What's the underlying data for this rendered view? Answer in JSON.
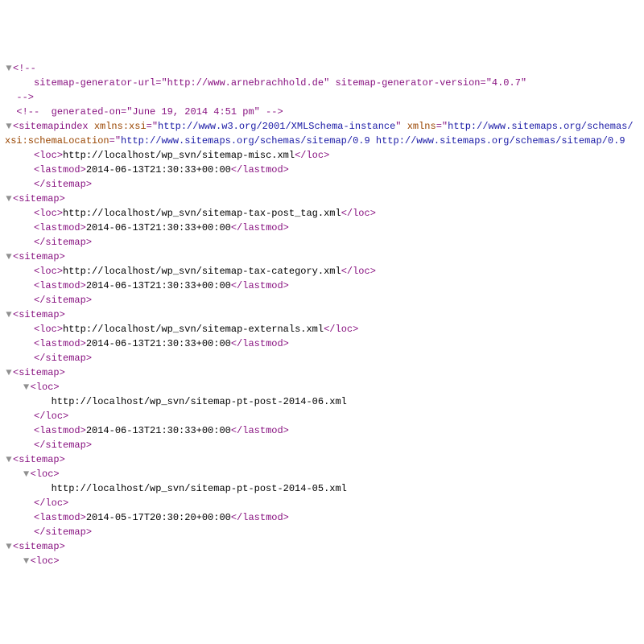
{
  "lines": [
    {
      "lvl": 0,
      "segs": [
        {
          "k": "arrow",
          "t": "▼"
        },
        {
          "c": "purple",
          "t": "<!--"
        }
      ]
    },
    {
      "lvl": 1,
      "segs": [
        {
          "c": "purple",
          "t": "sitemap-generator-url=\"http://www.arnebrachhold.de\" sitemap-generator-version=\"4.0.7\""
        }
      ]
    },
    {
      "lvl": 0,
      "segs": [
        {
          "c": "purple",
          "t": "-->"
        }
      ]
    },
    {
      "lvl": 0,
      "segs": [
        {
          "c": "purple",
          "t": "<!--  generated-on=\"June 19, 2014 4:51 pm\" -->"
        }
      ]
    },
    {
      "lvl": 0,
      "segs": [
        {
          "k": "arrow",
          "t": "▼"
        },
        {
          "c": "purple",
          "t": "<sitemapindex "
        },
        {
          "c": "brown",
          "t": "xmlns:xsi"
        },
        {
          "c": "purple",
          "t": "=\""
        },
        {
          "c": "blue",
          "t": "http://www.w3.org/2001/XMLSchema-instance"
        },
        {
          "c": "purple",
          "t": "\" "
        },
        {
          "c": "brown",
          "t": "xmlns"
        },
        {
          "c": "purple",
          "t": "=\""
        },
        {
          "c": "blue",
          "t": "http://www.sitemaps.org/schemas/"
        }
      ]
    },
    {
      "lvl": 0,
      "noindent": true,
      "segs": [
        {
          "c": "brown",
          "t": "xsi:schemaLocation"
        },
        {
          "c": "purple",
          "t": "=\""
        },
        {
          "c": "blue",
          "t": "http://www.sitemaps.org/schemas/sitemap/0.9 http://www.sitemaps.org/schemas/sitemap/0.9"
        }
      ]
    },
    {
      "lvl": 1,
      "segs": [
        {
          "c": "purple",
          "t": "<loc>"
        },
        {
          "c": "black",
          "t": "http://localhost/wp_svn/sitemap-misc.xml"
        },
        {
          "c": "purple",
          "t": "</loc>"
        }
      ]
    },
    {
      "lvl": 1,
      "segs": [
        {
          "c": "purple",
          "t": "<lastmod>"
        },
        {
          "c": "black",
          "t": "2014-06-13T21:30:33+00:00"
        },
        {
          "c": "purple",
          "t": "</lastmod>"
        }
      ]
    },
    {
      "lvl": 1,
      "segs": [
        {
          "c": "purple",
          "t": "</sitemap>"
        }
      ]
    },
    {
      "lvl": 0,
      "segs": [
        {
          "k": "arrow",
          "t": "▼"
        },
        {
          "c": "purple",
          "t": "<sitemap>"
        }
      ]
    },
    {
      "lvl": 1,
      "segs": [
        {
          "c": "purple",
          "t": "<loc>"
        },
        {
          "c": "black",
          "t": "http://localhost/wp_svn/sitemap-tax-post_tag.xml"
        },
        {
          "c": "purple",
          "t": "</loc>"
        }
      ]
    },
    {
      "lvl": 1,
      "segs": [
        {
          "c": "purple",
          "t": "<lastmod>"
        },
        {
          "c": "black",
          "t": "2014-06-13T21:30:33+00:00"
        },
        {
          "c": "purple",
          "t": "</lastmod>"
        }
      ]
    },
    {
      "lvl": 1,
      "segs": [
        {
          "c": "purple",
          "t": "</sitemap>"
        }
      ]
    },
    {
      "lvl": 0,
      "segs": [
        {
          "k": "arrow",
          "t": "▼"
        },
        {
          "c": "purple",
          "t": "<sitemap>"
        }
      ]
    },
    {
      "lvl": 1,
      "segs": [
        {
          "c": "purple",
          "t": "<loc>"
        },
        {
          "c": "black",
          "t": "http://localhost/wp_svn/sitemap-tax-category.xml"
        },
        {
          "c": "purple",
          "t": "</loc>"
        }
      ]
    },
    {
      "lvl": 1,
      "segs": [
        {
          "c": "purple",
          "t": "<lastmod>"
        },
        {
          "c": "black",
          "t": "2014-06-13T21:30:33+00:00"
        },
        {
          "c": "purple",
          "t": "</lastmod>"
        }
      ]
    },
    {
      "lvl": 1,
      "segs": [
        {
          "c": "purple",
          "t": "</sitemap>"
        }
      ]
    },
    {
      "lvl": 0,
      "segs": [
        {
          "k": "arrow",
          "t": "▼"
        },
        {
          "c": "purple",
          "t": "<sitemap>"
        }
      ]
    },
    {
      "lvl": 1,
      "segs": [
        {
          "c": "purple",
          "t": "<loc>"
        },
        {
          "c": "black",
          "t": "http://localhost/wp_svn/sitemap-externals.xml"
        },
        {
          "c": "purple",
          "t": "</loc>"
        }
      ]
    },
    {
      "lvl": 1,
      "segs": [
        {
          "c": "purple",
          "t": "<lastmod>"
        },
        {
          "c": "black",
          "t": "2014-06-13T21:30:33+00:00"
        },
        {
          "c": "purple",
          "t": "</lastmod>"
        }
      ]
    },
    {
      "lvl": 1,
      "segs": [
        {
          "c": "purple",
          "t": "</sitemap>"
        }
      ]
    },
    {
      "lvl": 0,
      "segs": [
        {
          "k": "arrow",
          "t": "▼"
        },
        {
          "c": "purple",
          "t": "<sitemap>"
        }
      ]
    },
    {
      "lvl": 1,
      "segs": [
        {
          "k": "arrow",
          "t": "▼"
        },
        {
          "c": "purple",
          "t": "<loc>"
        }
      ]
    },
    {
      "lvl": 2,
      "segs": [
        {
          "c": "black",
          "t": "http://localhost/wp_svn/sitemap-pt-post-2014-06.xml"
        }
      ]
    },
    {
      "lvl": 1,
      "segs": [
        {
          "c": "purple",
          "t": "</loc>"
        }
      ]
    },
    {
      "lvl": 1,
      "segs": [
        {
          "c": "purple",
          "t": "<lastmod>"
        },
        {
          "c": "black",
          "t": "2014-06-13T21:30:33+00:00"
        },
        {
          "c": "purple",
          "t": "</lastmod>"
        }
      ]
    },
    {
      "lvl": 1,
      "segs": [
        {
          "c": "purple",
          "t": "</sitemap>"
        }
      ]
    },
    {
      "lvl": 0,
      "segs": [
        {
          "k": "arrow",
          "t": "▼"
        },
        {
          "c": "purple",
          "t": "<sitemap>"
        }
      ]
    },
    {
      "lvl": 1,
      "segs": [
        {
          "k": "arrow",
          "t": "▼"
        },
        {
          "c": "purple",
          "t": "<loc>"
        }
      ]
    },
    {
      "lvl": 2,
      "segs": [
        {
          "c": "black",
          "t": "http://localhost/wp_svn/sitemap-pt-post-2014-05.xml"
        }
      ]
    },
    {
      "lvl": 1,
      "segs": [
        {
          "c": "purple",
          "t": "</loc>"
        }
      ]
    },
    {
      "lvl": 1,
      "segs": [
        {
          "c": "purple",
          "t": "<lastmod>"
        },
        {
          "c": "black",
          "t": "2014-05-17T20:30:20+00:00"
        },
        {
          "c": "purple",
          "t": "</lastmod>"
        }
      ]
    },
    {
      "lvl": 1,
      "segs": [
        {
          "c": "purple",
          "t": "</sitemap>"
        }
      ]
    },
    {
      "lvl": 0,
      "segs": [
        {
          "k": "arrow",
          "t": "▼"
        },
        {
          "c": "purple",
          "t": "<sitemap>"
        }
      ]
    },
    {
      "lvl": 1,
      "segs": [
        {
          "k": "arrow",
          "t": "▼"
        },
        {
          "c": "purple",
          "t": "<loc>"
        }
      ]
    }
  ]
}
